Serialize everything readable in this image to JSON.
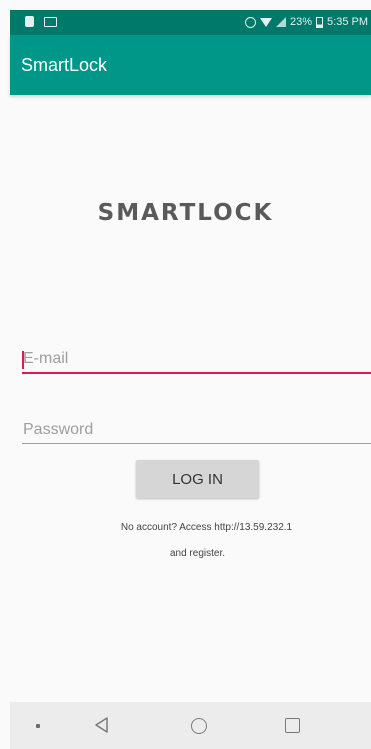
{
  "status_bar": {
    "battery": "23%",
    "time": "5:35 PM"
  },
  "app_bar": {
    "title": "SmartLock"
  },
  "logo": {
    "text": "SMARTLOCK"
  },
  "form": {
    "email_placeholder": "E-mail",
    "password_placeholder": "Password",
    "login_label": "LOG IN"
  },
  "info": {
    "line1": "No account? Access http://13.59.232.1",
    "line2": "and register."
  },
  "colors": {
    "primary": "#009688",
    "primary_dark": "#00796b",
    "accent": "#d81b60"
  },
  "icons": [
    "notification-icon",
    "cast-icon",
    "alarm-icon",
    "wifi-icon",
    "signal-icon",
    "battery-icon",
    "back-icon",
    "home-icon",
    "recents-icon"
  ]
}
